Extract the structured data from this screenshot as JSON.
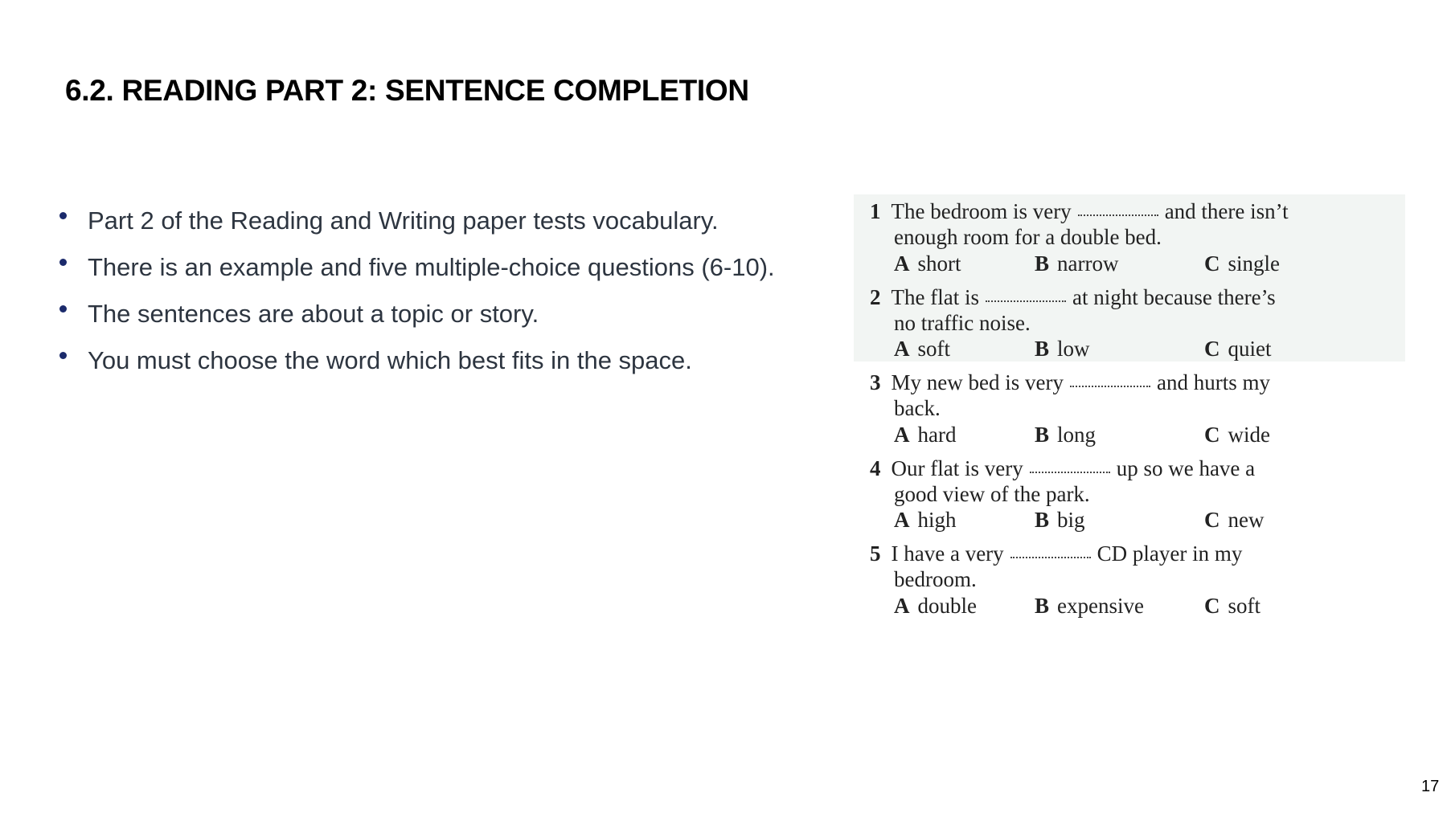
{
  "title": "6.2. READING PART 2: SENTENCE COMPLETION",
  "bullets": [
    "Part 2 of the Reading and Writing paper tests vocabulary.",
    "There is an example and five multiple-choice questions (6-10).",
    "The sentences are about a topic or story.",
    "You must choose the word which best fits in the space."
  ],
  "questions": [
    {
      "number": "1",
      "before": "The bedroom is very",
      "after": "and there isn’t",
      "line2": "enough room for a double bed.",
      "options": [
        {
          "letter": "A",
          "text": "short"
        },
        {
          "letter": "B",
          "text": "narrow"
        },
        {
          "letter": "C",
          "text": "single"
        }
      ]
    },
    {
      "number": "2",
      "before": "The flat is",
      "after": "at night because there’s",
      "line2": "no traffic noise.",
      "options": [
        {
          "letter": "A",
          "text": "soft"
        },
        {
          "letter": "B",
          "text": "low"
        },
        {
          "letter": "C",
          "text": "quiet"
        }
      ]
    },
    {
      "number": "3",
      "before": "My new bed is very",
      "after": "and hurts my",
      "line2": "back.",
      "options": [
        {
          "letter": "A",
          "text": "hard"
        },
        {
          "letter": "B",
          "text": "long"
        },
        {
          "letter": "C",
          "text": "wide"
        }
      ]
    },
    {
      "number": "4",
      "before": "Our flat is very",
      "after": "up so we have a",
      "line2": "good view of the park.",
      "options": [
        {
          "letter": "A",
          "text": "high"
        },
        {
          "letter": "B",
          "text": "big"
        },
        {
          "letter": "C",
          "text": "new"
        }
      ]
    },
    {
      "number": "5",
      "before": "I have a very",
      "after": "CD player in my",
      "line2": "bedroom.",
      "options": [
        {
          "letter": "A",
          "text": "double"
        },
        {
          "letter": "B",
          "text": "expensive"
        },
        {
          "letter": "C",
          "text": "soft"
        }
      ]
    }
  ],
  "page_number": "17",
  "colors": {
    "bullet": "#1b2a6b",
    "body_text": "#2d3540",
    "exercise_background": "#f2f5f3"
  }
}
